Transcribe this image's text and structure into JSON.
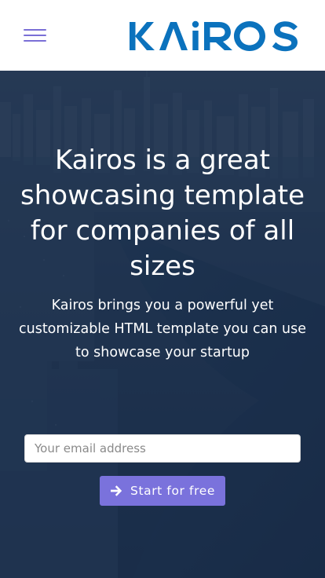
{
  "brand": {
    "logo_text": "KAiROS",
    "logo_color": "#0b72bd"
  },
  "header": {
    "menu_icon": "hamburger-menu-icon"
  },
  "hero": {
    "title": "Kairos is a great showcasing template for companies of all sizes",
    "subtitle": "Kairos brings you a powerful yet customizable HTML template you can use to showcase your startup",
    "email_placeholder": "Your email address",
    "email_value": "",
    "cta_label": "Start for free",
    "cta_icon": "arrow-right-icon",
    "cta_color": "#7a72dc",
    "background_image": "city-skyline-aerial"
  }
}
